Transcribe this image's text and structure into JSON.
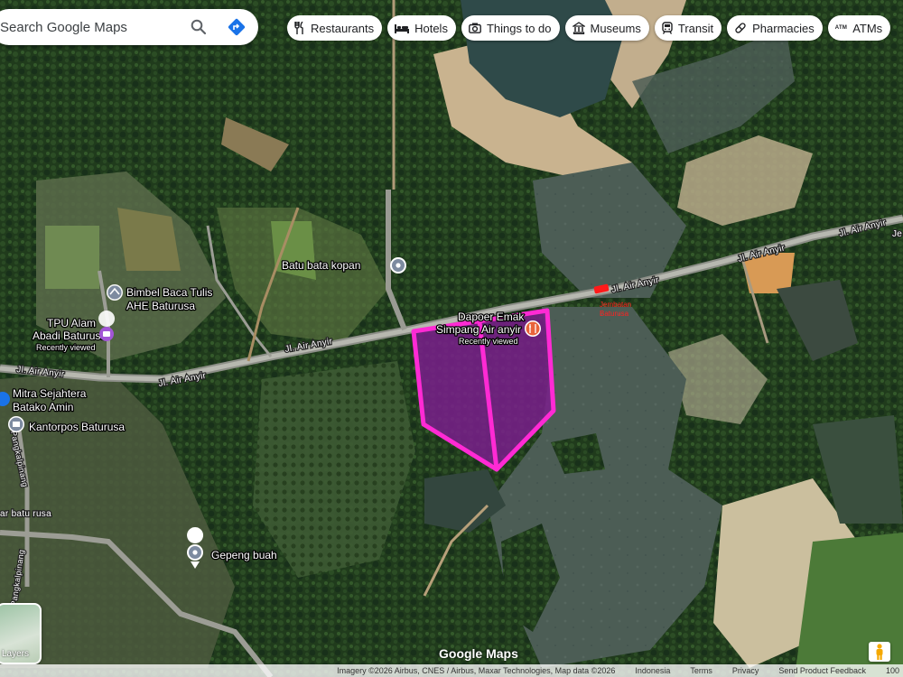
{
  "search": {
    "placeholder": "Search Google Maps"
  },
  "chips": [
    {
      "label": "Restaurants",
      "icon": "fork-knife-icon"
    },
    {
      "label": "Hotels",
      "icon": "bed-icon"
    },
    {
      "label": "Things to do",
      "icon": "camera-icon"
    },
    {
      "label": "Museums",
      "icon": "museum-icon"
    },
    {
      "label": "Transit",
      "icon": "train-icon"
    },
    {
      "label": "Pharmacies",
      "icon": "pill-icon"
    },
    {
      "label": "ATMs",
      "icon": "atm-icon",
      "badge": "ATM"
    }
  ],
  "map": {
    "roads": {
      "air_anyir_west": "Jl. Air Anyir",
      "air_anyir_mid": "Jl. Air Anyir",
      "air_anyir_east1": "Jl. Air Anyir",
      "air_anyir_east2": "Jl. Air Anyir",
      "air_anyir_edge": "Je",
      "pangkalpinang_top": "Pangkalpinang",
      "pangkalpinang_bottom": "Pangkalpinang",
      "batu_rusa_frag": "ar batu rusa"
    },
    "places": {
      "bimbel_1": "Bimbel Baca Tulis",
      "bimbel_2": "AHE Baturusa",
      "tpu_1": "TPU Alam",
      "tpu_2": "Abadi Baturusa",
      "recently_viewed": "Recently viewed",
      "batu_bata": "Batu bata kopan",
      "dapoer_1": "Dapoer Emak",
      "dapoer_2": "Simpang Air anyir",
      "mitra_1": "Mitra Sejahtera",
      "mitra_2": "Batako Amin",
      "kantorpos": "Kantorpos Baturusa",
      "gepeng": "Gepeng buah",
      "red_1": "Jembatan",
      "red_2": "Baturusa"
    },
    "colors": {
      "parcel_outline": "#ff2ad4",
      "parcel_fill": "#7a1f8c",
      "road_marker": "#ff1a1a",
      "pin_purple": "#a256d6",
      "pin_blue": "#1a73e8",
      "pin_orange": "#e8633a"
    }
  },
  "controls": {
    "layers_label": "Layers",
    "google_logo": "Google Maps"
  },
  "footer": {
    "attribution": "Imagery ©2026 Airbus, CNES / Airbus, Maxar Technologies, Map data ©2026",
    "links": [
      "Indonesia",
      "Terms",
      "Privacy",
      "Send Product Feedback"
    ],
    "scale": "100"
  }
}
